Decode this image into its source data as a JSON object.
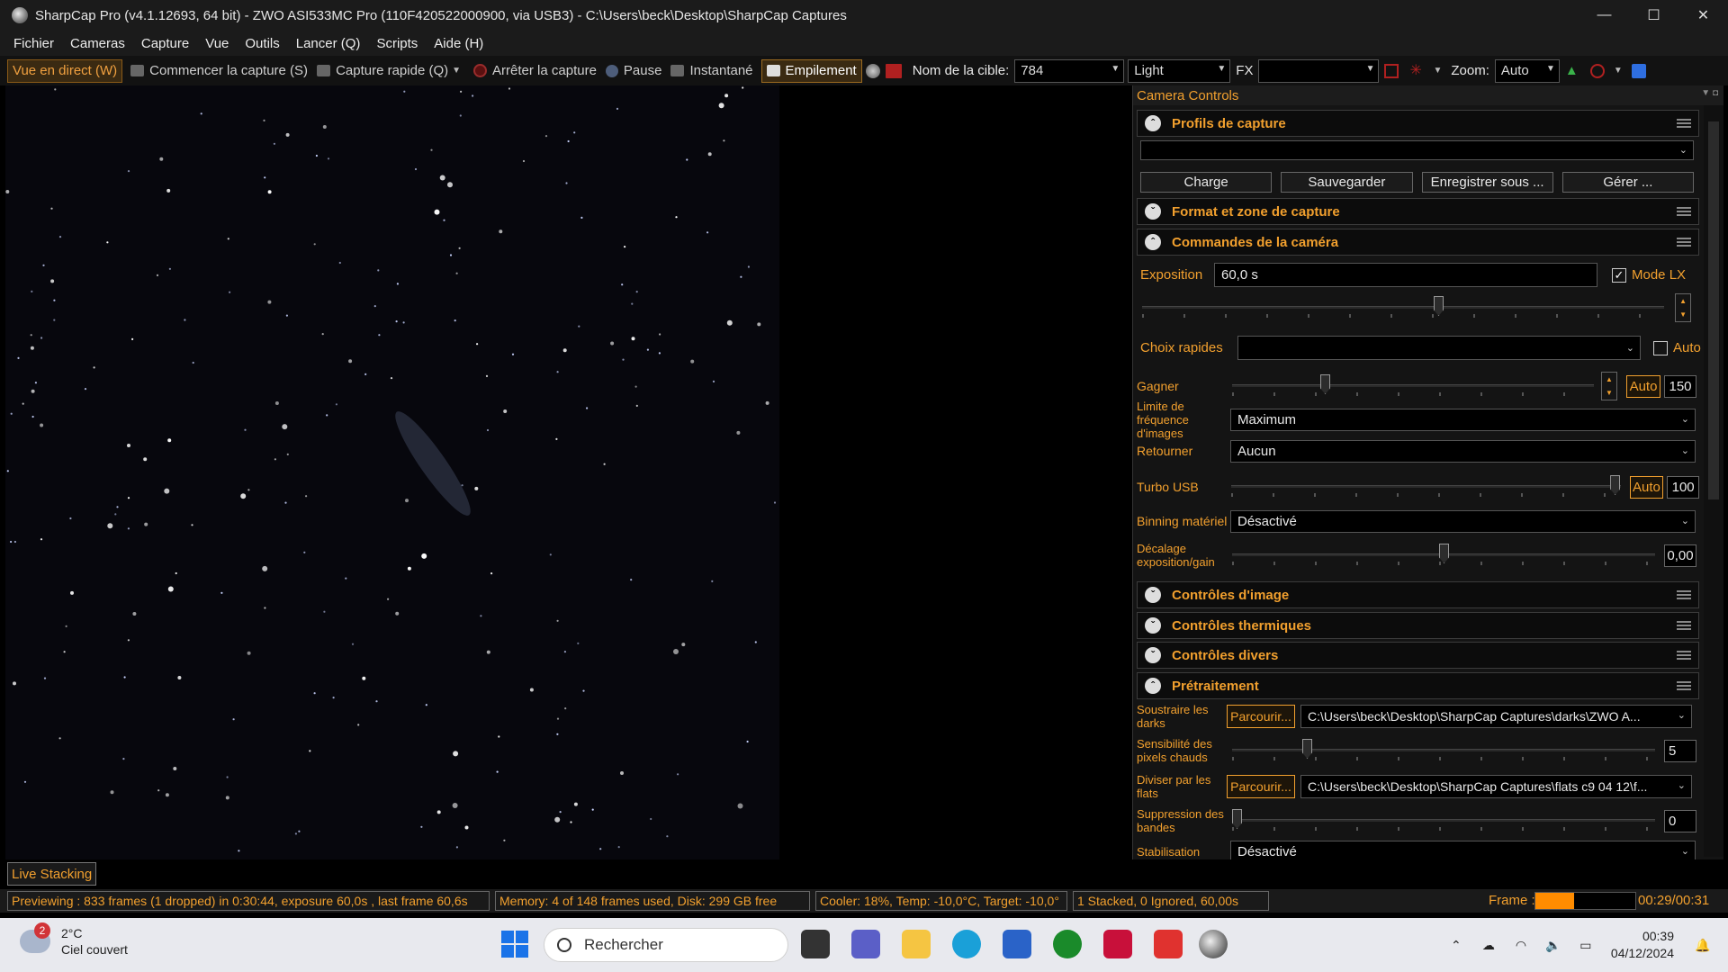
{
  "window": {
    "title": "SharpCap Pro (v4.1.12693, 64 bit) - ZWO ASI533MC Pro (110F420522000900, via USB3) - C:\\Users\\beck\\Desktop\\SharpCap Captures",
    "minimize": "—",
    "maximize": "☐",
    "close": "✕"
  },
  "menu": [
    "Fichier",
    "Cameras",
    "Capture",
    "Vue",
    "Outils",
    "Lancer (Q)",
    "Scripts",
    "Aide (H)"
  ],
  "toolbar": {
    "live_view": "Vue en direct (W)",
    "start_capture": "Commencer la capture (S)",
    "quick_capture": "Capture rapide (Q)",
    "stop_capture": "Arrêter la capture",
    "pause": "Pause",
    "snapshot": "Instantané",
    "stacking": "Empilement",
    "target_label": "Nom de la cible:",
    "target_value": "784",
    "frame_type": "Light",
    "fx_label": "FX",
    "fx_value": "",
    "zoom_label": "Zoom:",
    "zoom_value": "Auto"
  },
  "preview": {
    "tab_label": "Live Stacking"
  },
  "panel": {
    "title": "Camera Controls",
    "sections": {
      "profiles": "Profils de capture",
      "format": "Format et zone de capture",
      "camera": "Commandes de la caméra",
      "image": "Contrôles d'image",
      "thermal": "Contrôles thermiques",
      "misc": "Contrôles divers",
      "preprocessing": "Prétraitement"
    },
    "profiles": {
      "selected": "",
      "load": "Charge",
      "save": "Sauvegarder",
      "save_as": "Enregistrer sous ...",
      "manage": "Gérer ..."
    },
    "camera": {
      "exposure_label": "Exposition",
      "exposure_value": "60,0 s",
      "lx_mode_label": "Mode LX",
      "lx_mode_checked": true,
      "exposure_slider_fraction": 0.57,
      "quick_picks_label": "Choix rapides",
      "quick_picks_value": "",
      "quick_auto_label": "Auto",
      "gain_label": "Gagner",
      "gain_auto": "Auto",
      "gain_value": "150",
      "gain_fraction": 0.25,
      "fps_limit_label": "Limite de fréquence d'images",
      "fps_limit_value": "Maximum",
      "flip_label": "Retourner",
      "flip_value": "Aucun",
      "usb_turbo_label": "Turbo USB",
      "usb_turbo_auto": "Auto",
      "usb_turbo_value": "100",
      "usb_turbo_fraction": 1.0,
      "hw_binning_label": "Binning matériel",
      "hw_binning_value": "Désactivé",
      "exp_gain_offset_label": "Décalage exposition/gain",
      "exp_gain_offset_value": "0,00",
      "exp_gain_offset_fraction": 0.5
    },
    "preprocessing": {
      "subtract_darks_label": "Soustraire les darks",
      "browse": "Parcourir...",
      "darks_path": "C:\\Users\\beck\\Desktop\\SharpCap Captures\\darks\\ZWO A...",
      "hot_pixel_label": "Sensibilité des pixels chauds",
      "hot_pixel_value": "5",
      "hot_pixel_fraction": 0.17,
      "divide_flats_label": "Diviser par les flats",
      "flats_path": "C:\\Users\\beck\\Desktop\\SharpCap Captures\\flats c9 04 12\\f...",
      "banding_label": "Suppression des bandes",
      "banding_value": "0",
      "banding_fraction": 0.0,
      "stabilisation_label": "Stabilisation",
      "stabilisation_value": "Désactivé"
    }
  },
  "status": {
    "preview": "Previewing : 833 frames (1 dropped) in 0:30:44, exposure 60,0s , last frame 60,6s",
    "memory": "Memory: 4 of 148 frames used, Disk: 299 GB free",
    "cooler": "Cooler: 18%, Temp: -10,0°C, Target: -10,0°",
    "stacked": "1 Stacked, 0 Ignored, 60,00s",
    "frame_label": "Frame :",
    "frame_progress": 0.39,
    "frame_time": "00:29/00:31"
  },
  "taskbar": {
    "weather_badge": "2",
    "temperature": "2°C",
    "weather_desc": "Ciel couvert",
    "search_placeholder": "Rechercher",
    "time": "00:39",
    "date": "04/12/2024"
  },
  "colors": {
    "accent": "#f2a02e",
    "progress": "#ff8c00",
    "background": "#141414"
  }
}
